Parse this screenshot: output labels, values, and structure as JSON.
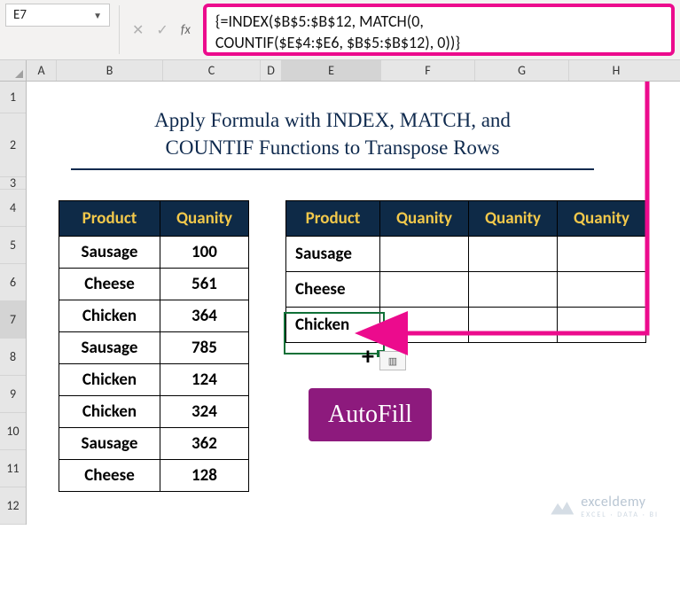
{
  "namebox": {
    "value": "E7"
  },
  "formula_bar": {
    "line1": "{=INDEX($B$5:$B$12, MATCH(0,",
    "line2": "COUNTIF($E$4:$E6, $B$5:$B$12), 0))}"
  },
  "columns": {
    "A": "A",
    "B": "B",
    "C": "C",
    "D": "D",
    "E": "E",
    "F": "F",
    "G": "G",
    "H": "H"
  },
  "rows": [
    "1",
    "2",
    "3",
    "4",
    "5",
    "6",
    "7",
    "8",
    "9",
    "10",
    "11",
    "12"
  ],
  "title": {
    "line1": "Apply Formula with INDEX, MATCH, and",
    "line2": "COUNTIF Functions to Transpose Rows"
  },
  "left_table": {
    "headers": [
      "Product",
      "Quanity"
    ],
    "rows": [
      [
        "Sausage",
        "100"
      ],
      [
        "Cheese",
        "561"
      ],
      [
        "Chicken",
        "364"
      ],
      [
        "Sausage",
        "785"
      ],
      [
        "Chicken",
        "124"
      ],
      [
        "Chicken",
        "324"
      ],
      [
        "Sausage",
        "362"
      ],
      [
        "Cheese",
        "128"
      ]
    ]
  },
  "right_table": {
    "headers": [
      "Product",
      "Quanity",
      "Quanity",
      "Quanity"
    ],
    "rows": [
      [
        "Sausage",
        "",
        "",
        ""
      ],
      [
        "Cheese",
        "",
        "",
        ""
      ],
      [
        "Chicken",
        "",
        "",
        ""
      ]
    ]
  },
  "autofill_label": "AutoFill",
  "watermark": {
    "brand": "exceldemy",
    "tagline": "EXCEL · DATA · BI"
  },
  "colors": {
    "accent": "#ec0b8d",
    "header_bg": "#0e2a47",
    "header_fg": "#f2c84b",
    "sel": "#0f7037",
    "purple": "#8d1a7d"
  }
}
